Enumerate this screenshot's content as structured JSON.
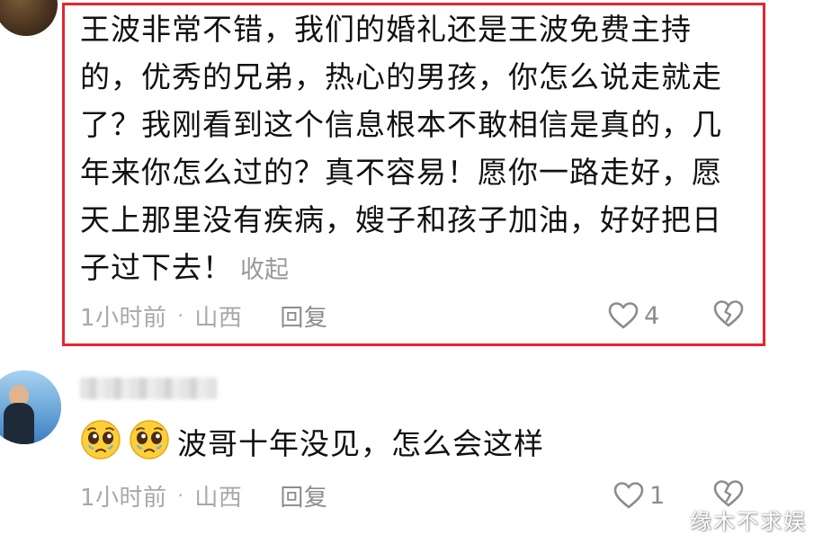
{
  "comments": [
    {
      "text": "王波非常不错，我们的婚礼还是王波免费主持的，优秀的兄弟，热心的男孩，你怎么说走就走了？我刚看到这个信息根本不敢相信是真的，几年来你怎么过的？真不容易！愿你一路走好，愿天上那里没有疾病，嫂子和孩子加油，好好把日子过下去！",
      "collapse_label": "收起",
      "time": "1小时前",
      "separator": "·",
      "location": "山西",
      "reply_label": "回复",
      "like_count": "4"
    },
    {
      "text": "波哥十年没见，怎么会这样",
      "time": "1小时前",
      "separator": "·",
      "location": "山西",
      "reply_label": "回复",
      "like_count": "1"
    }
  ],
  "watermark": "缘木不求娱",
  "icons": {
    "like": "heart-outline-icon",
    "dislike": "broken-heart-icon",
    "emoji": "pleading-face-emoji-icon"
  },
  "colors": {
    "highlight_border": "#e8242e",
    "meta_text": "#a8a8a8",
    "body_text": "#111111"
  }
}
